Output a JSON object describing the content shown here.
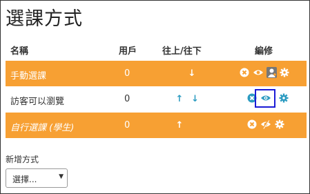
{
  "page": {
    "title": "選課方式"
  },
  "table": {
    "headers": {
      "name": "名稱",
      "users": "用戶",
      "updown": "往上/往下",
      "edit": "編修"
    },
    "rows": [
      {
        "name": "手動選課",
        "users": "0",
        "style": "highlight",
        "italic": false
      },
      {
        "name": "訪客可以瀏覽",
        "users": "0",
        "style": "plain",
        "italic": false
      },
      {
        "name": "自行選課 (學生)",
        "users": "0",
        "style": "highlight",
        "italic": true
      }
    ]
  },
  "add_method": {
    "label": "新增方式",
    "select_value": "選擇..."
  },
  "colors": {
    "highlight_row": "#f7a033",
    "link": "#2b9bc1",
    "focus_box": "#1a1ad6"
  },
  "icons": {
    "up": "arrow-up-icon",
    "down": "arrow-down-icon",
    "delete": "delete-icon",
    "show": "eye-icon",
    "hide": "eye-slash-icon",
    "enrol_users": "enrol-users-icon",
    "settings": "gear-icon"
  }
}
